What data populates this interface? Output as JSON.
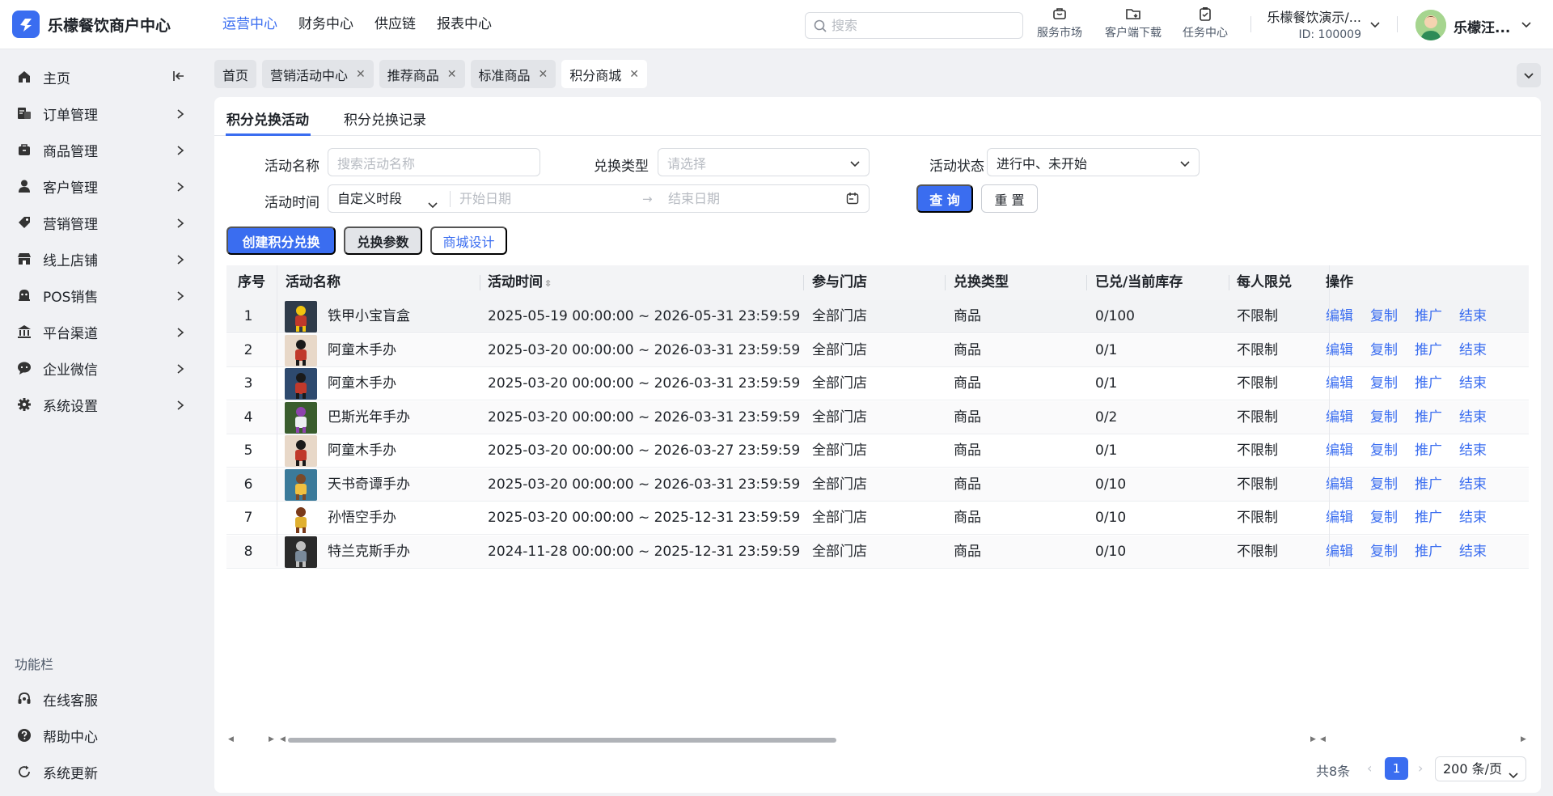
{
  "app": {
    "title": "乐檬餐饮商户中心"
  },
  "topnav": [
    "运营中心",
    "财务中心",
    "供应链",
    "报表中心"
  ],
  "search": {
    "placeholder": "搜索"
  },
  "tools": [
    "服务市场",
    "客户端下载",
    "任务中心"
  ],
  "store": {
    "name": "乐檬餐饮演示/...",
    "id": "ID: 100009"
  },
  "user": {
    "name": "乐檬汪..."
  },
  "sidebar": {
    "items": [
      {
        "label": "主页",
        "icon": "home-icon"
      },
      {
        "label": "订单管理",
        "icon": "order-icon"
      },
      {
        "label": "商品管理",
        "icon": "goods-icon"
      },
      {
        "label": "客户管理",
        "icon": "customer-icon"
      },
      {
        "label": "营销管理",
        "icon": "tag-icon"
      },
      {
        "label": "线上店铺",
        "icon": "shop-icon"
      },
      {
        "label": "POS销售",
        "icon": "pos-icon"
      },
      {
        "label": "平台渠道",
        "icon": "bank-icon"
      },
      {
        "label": "企业微信",
        "icon": "chat-icon"
      },
      {
        "label": "系统设置",
        "icon": "gear-icon"
      }
    ],
    "section_title": "功能栏",
    "bottom_items": [
      {
        "label": "在线客服",
        "icon": "headset-icon"
      },
      {
        "label": "帮助中心",
        "icon": "help-icon"
      },
      {
        "label": "系统更新",
        "icon": "refresh-icon"
      }
    ]
  },
  "page_tabs": [
    {
      "label": "首页",
      "closable": false
    },
    {
      "label": "营销活动中心",
      "closable": true
    },
    {
      "label": "推荐商品",
      "closable": true
    },
    {
      "label": "标准商品",
      "closable": true
    },
    {
      "label": "积分商城",
      "closable": true,
      "active": true
    }
  ],
  "subtabs": [
    "积分兑换活动",
    "积分兑换记录"
  ],
  "filters": {
    "name_label": "活动名称",
    "name_placeholder": "搜索活动名称",
    "type_label": "兑换类型",
    "type_placeholder": "请选择",
    "status_label": "活动状态",
    "status_value": "进行中、未开始",
    "time_label": "活动时间",
    "time_mode": "自定义时段",
    "start_placeholder": "开始日期",
    "end_placeholder": "结束日期",
    "query_button": "查 询",
    "reset_button": "重 置"
  },
  "actions": {
    "create": "创建积分兑换",
    "params": "兑换参数",
    "design": "商城设计"
  },
  "table": {
    "columns": [
      "序号",
      "活动名称",
      "活动时间",
      "参与门店",
      "兑换类型",
      "已兑/当前库存",
      "每人限兑",
      "操作"
    ],
    "rows": [
      [
        "1",
        "铁甲小宝盲盒",
        "2025-05-19 00:00:00 ~ 2026-05-31 23:59:59",
        "全部门店",
        "商品",
        "0/100",
        "不限制"
      ],
      [
        "2",
        "阿童木手办",
        "2025-03-20 00:00:00 ~ 2026-03-31 23:59:59",
        "全部门店",
        "商品",
        "0/1",
        "不限制"
      ],
      [
        "3",
        "阿童木手办",
        "2025-03-20 00:00:00 ~ 2026-03-31 23:59:59",
        "全部门店",
        "商品",
        "0/1",
        "不限制"
      ],
      [
        "4",
        "巴斯光年手办",
        "2025-03-20 00:00:00 ~ 2026-03-31 23:59:59",
        "全部门店",
        "商品",
        "0/2",
        "不限制"
      ],
      [
        "5",
        "阿童木手办",
        "2025-03-20 00:00:00 ~ 2026-03-27 23:59:59",
        "全部门店",
        "商品",
        "0/1",
        "不限制"
      ],
      [
        "6",
        "天书奇谭手办",
        "2025-03-20 00:00:00 ~ 2026-03-31 23:59:59",
        "全部门店",
        "商品",
        "0/10",
        "不限制"
      ],
      [
        "7",
        "孙悟空手办",
        "2025-03-20 00:00:00 ~ 2025-12-31 23:59:59",
        "全部门店",
        "商品",
        "0/10",
        "不限制"
      ],
      [
        "8",
        "特兰克斯手办",
        "2024-11-28 00:00:00 ~ 2025-12-31 23:59:59",
        "全部门店",
        "商品",
        "0/10",
        "不限制"
      ]
    ],
    "ops": [
      "编辑",
      "复制",
      "推广",
      "结束"
    ]
  },
  "pagination": {
    "total": "共8条",
    "current": "1",
    "page_size": "200 条/页"
  },
  "colors": {
    "accent": "#3a6df0",
    "sidebar_bg": "#f0f1f4"
  }
}
